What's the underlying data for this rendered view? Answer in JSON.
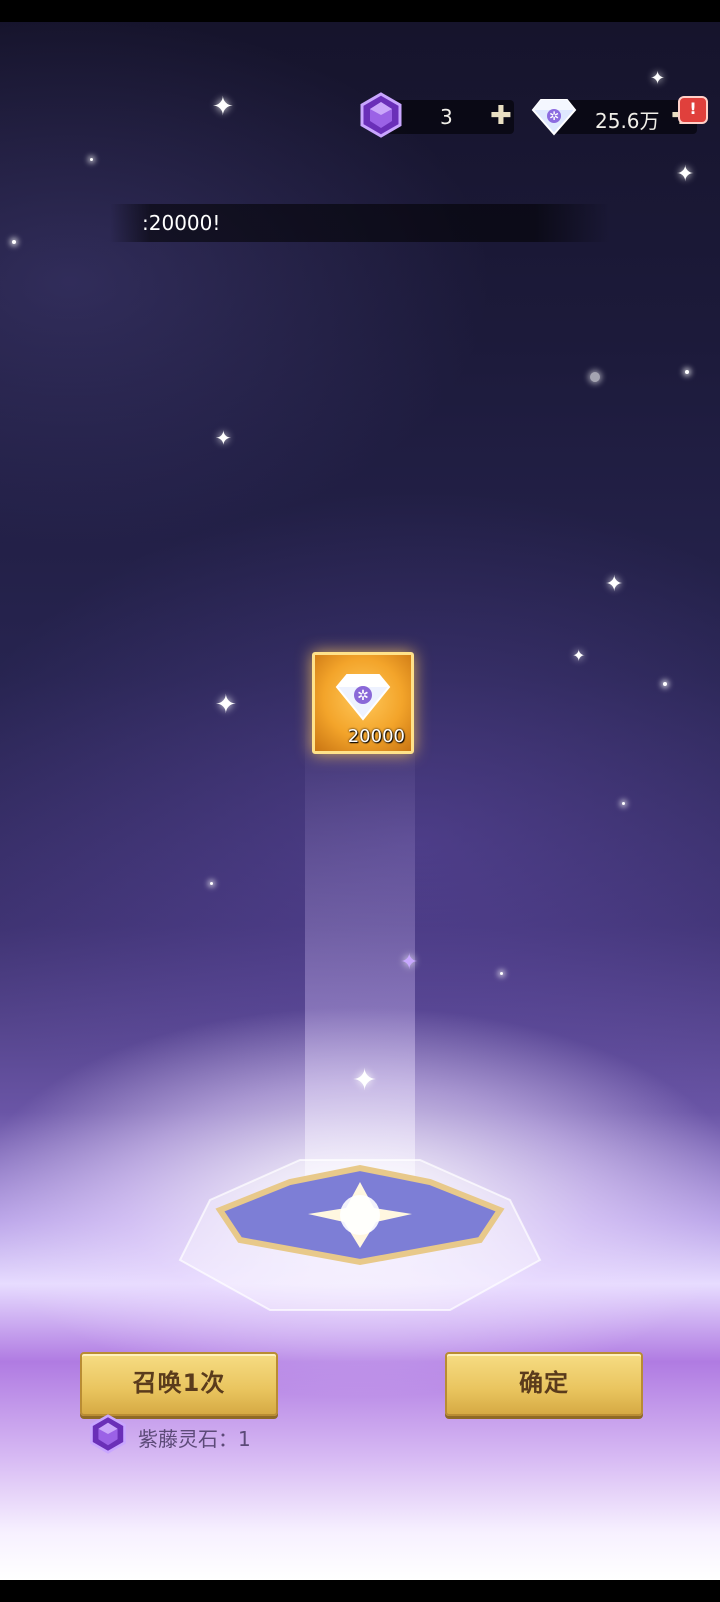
{
  "resources": {
    "stone": {
      "icon": "purple-gem-icon",
      "value": "3"
    },
    "diamond": {
      "icon": "diamond-icon",
      "value": "25.6万"
    }
  },
  "banner": {
    "text": ":20000!"
  },
  "reward": {
    "icon": "diamond-icon",
    "amount": "20000"
  },
  "actions": {
    "summon_label": "召唤1次",
    "confirm_label": "确定"
  },
  "cost": {
    "icon": "purple-gem-icon",
    "label": "紫藤灵石：1"
  },
  "colors": {
    "button_gold": "#e9c45e",
    "button_text": "#5a3b1c",
    "reward_orange": "#f3a42a",
    "alert_red": "#e0403c"
  }
}
